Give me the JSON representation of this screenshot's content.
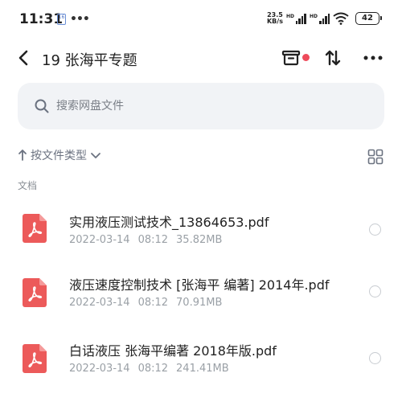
{
  "status_bar": {
    "time": "11:31",
    "notif_badge": "16",
    "more": "•••",
    "net_speed_value": "23.5",
    "net_speed_unit": "KB/s",
    "signal1_label": "HD",
    "signal2_label": "HD",
    "battery": "42"
  },
  "header": {
    "title": "19 张海平专题"
  },
  "search": {
    "placeholder": "搜索网盘文件"
  },
  "sort": {
    "label": "按文件类型"
  },
  "section": {
    "label": "文档"
  },
  "files": [
    {
      "name": "实用液压测试技术_13864653.pdf",
      "date": "2022-03-14",
      "time": "08:12",
      "size": "35.82MB"
    },
    {
      "name": "液压速度控制技术 [张海平 编著] 2014年.pdf",
      "date": "2022-03-14",
      "time": "08:12",
      "size": "70.91MB"
    },
    {
      "name": "白话液压 张海平编著 2018年版.pdf",
      "date": "2022-03-14",
      "time": "08:12",
      "size": "241.41MB"
    }
  ],
  "colors": {
    "pdf_red": "#ec5a5a",
    "accent_dot": "#ee4b5b",
    "search_bg": "#f1f3f6"
  }
}
